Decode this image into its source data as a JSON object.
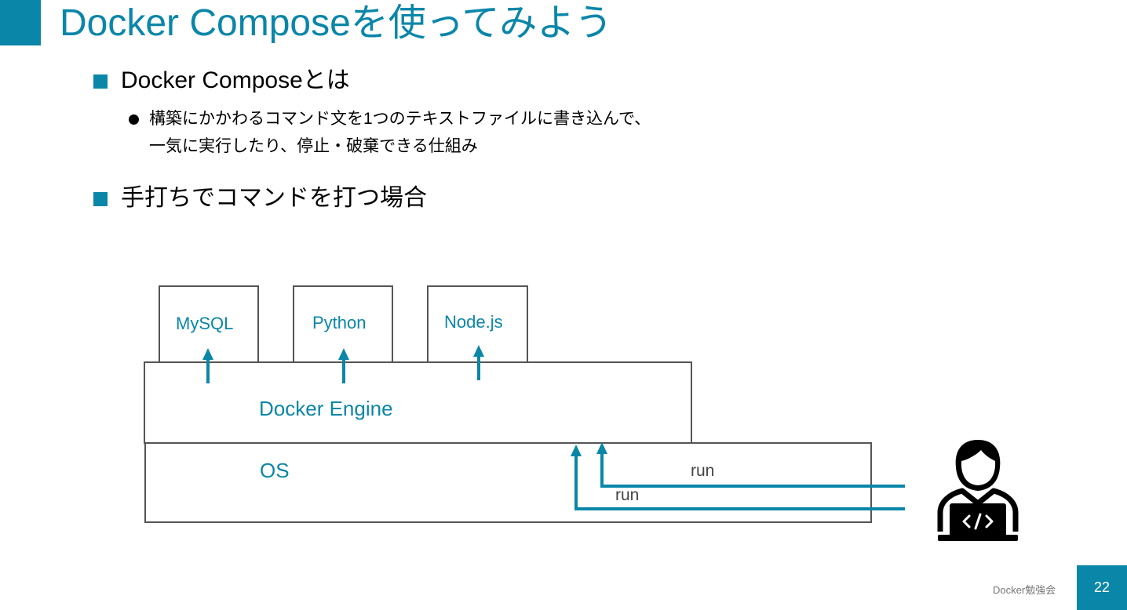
{
  "slide": {
    "title": "Docker Composeを使ってみよう",
    "bullet1": "Docker Composeとは",
    "sub_bullet_line1": "構築にかかわるコマンド文を1つのテキストファイルに書き込んで、",
    "sub_bullet_line2": "一気に実行したり、停止・破棄できる仕組み",
    "bullet2": "手打ちでコマンドを打つ場合"
  },
  "diagram": {
    "containers": [
      "MySQL",
      "Python",
      "Node.js"
    ],
    "engine_label": "Docker Engine",
    "os_label": "OS",
    "run_labels": [
      "run",
      "run"
    ],
    "accent_color": "#0a86a9",
    "icon": "developer-laptop-icon"
  },
  "footer": {
    "label": "Docker勉強会",
    "page_number": "22"
  }
}
